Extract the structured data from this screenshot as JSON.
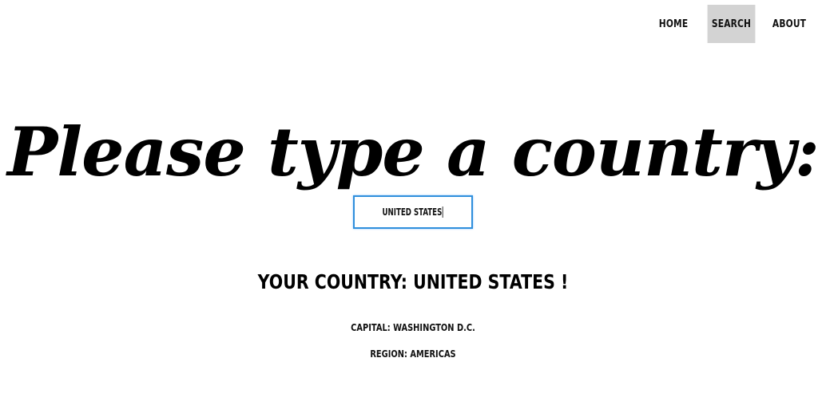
{
  "nav": {
    "items": [
      {
        "label": "HOME",
        "active": false
      },
      {
        "label": "SEARCH",
        "active": true
      },
      {
        "label": "ABOUT",
        "active": false
      }
    ]
  },
  "headline": "Please type a country:",
  "search": {
    "value": "UNITED STATES"
  },
  "result": {
    "title": "YOUR COUNTRY: UNITED STATES !",
    "capital": "CAPITAL: WASHINGTON D.C.",
    "region": "REGION: AMERICAS"
  },
  "colors": {
    "active_nav_bg": "#d3d3d3",
    "input_border": "#2f8fdc"
  }
}
